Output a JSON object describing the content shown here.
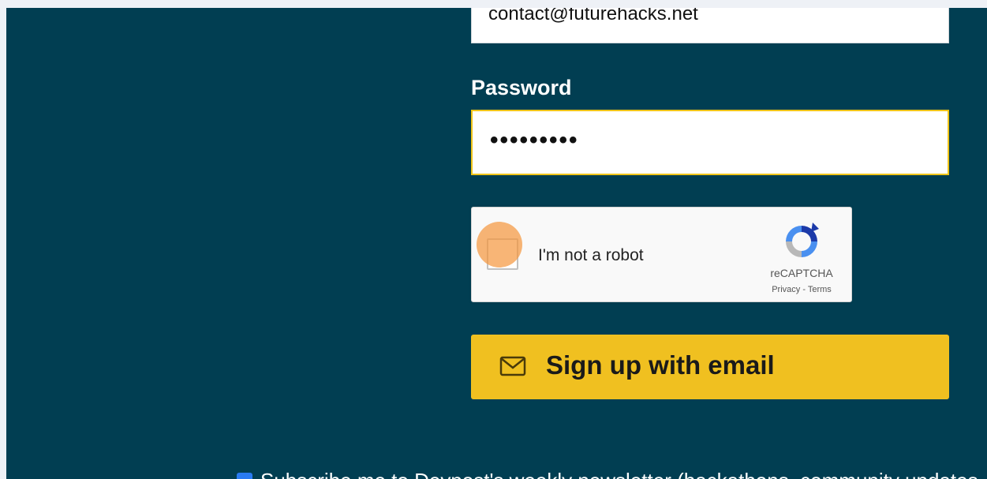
{
  "form": {
    "email": {
      "value": "contact@futurehacks.net"
    },
    "password": {
      "label": "Password",
      "masked_value": "•••••••••"
    },
    "captcha": {
      "label": "I'm not a robot",
      "brand": "reCAPTCHA",
      "links": "Privacy - Terms",
      "checked": false
    },
    "signup_button": {
      "label": "Sign up with email",
      "icon": "mail-icon"
    },
    "subscribe": {
      "label": "Subscribe me to Devpost's weekly newsletter (hackathons, community updates",
      "checked": true
    }
  },
  "colors": {
    "background": "#013e52",
    "accent": "#f0c020",
    "focus_border": "#f0c419",
    "click_marker": "#f5963c"
  }
}
